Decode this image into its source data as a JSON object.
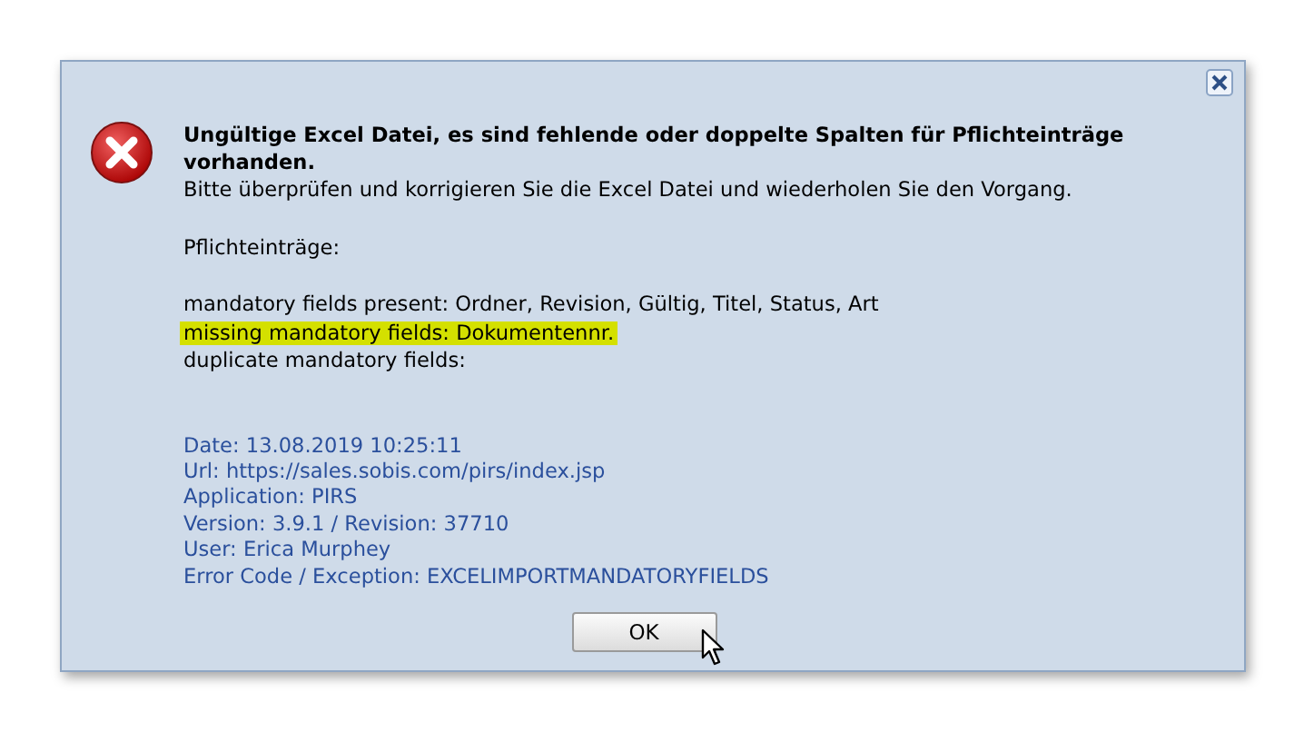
{
  "dialog": {
    "heading": "Ungültige Excel Datei, es sind fehlende oder doppelte Spalten für Pflichteinträge vorhanden.",
    "message": "Bitte überprüfen und korrigieren Sie die Excel Datei und wiederholen Sie den Vorgang.",
    "section_label": "Pflichteinträge:",
    "fields": [
      {
        "text": "mandatory fields present: Ordner, Revision, Gültig, Titel, Status, Art",
        "highlighted": false
      },
      {
        "text": "missing mandatory fields: Dokumentennr.",
        "highlighted": true
      },
      {
        "text": "duplicate mandatory fields:",
        "highlighted": false
      }
    ],
    "details": [
      "Date: 13.08.2019 10:25:11",
      "Url: https://sales.sobis.com/pirs/index.jsp",
      "Application: PIRS",
      "Version: 3.9.1 / Revision: 37710",
      "User: Erica Murphey",
      "Error Code / Exception: EXCELIMPORTMANDATORYFIELDS"
    ],
    "button": "OK"
  }
}
